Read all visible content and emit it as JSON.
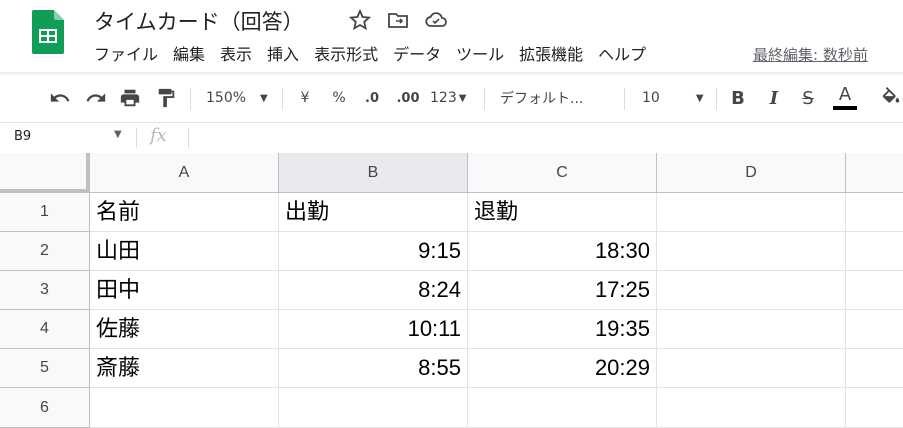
{
  "header": {
    "title": "タイムカード（回答）",
    "menus": [
      "ファイル",
      "編集",
      "表示",
      "挿入",
      "表示形式",
      "データ",
      "ツール",
      "拡張機能",
      "ヘルプ"
    ],
    "last_edit": "最終編集: 数秒前"
  },
  "toolbar": {
    "zoom": "150%",
    "currency": "¥",
    "percent": "%",
    "decrease_decimal": ".0",
    "increase_decimal": ".00",
    "number_format": "123",
    "font": "デフォルト...",
    "font_size": "10",
    "bold": "B",
    "italic": "I",
    "strike": "S",
    "text_color": "A"
  },
  "formula_bar": {
    "name_box": "B9",
    "fx": "fx",
    "value": ""
  },
  "grid": {
    "columns": [
      "A",
      "B",
      "C",
      "D"
    ],
    "rows": [
      "1",
      "2",
      "3",
      "4",
      "5",
      "6"
    ],
    "cells": [
      [
        "名前",
        "出勤",
        "退勤",
        ""
      ],
      [
        "山田",
        "9:15",
        "18:30",
        ""
      ],
      [
        "田中",
        "8:24",
        "17:25",
        ""
      ],
      [
        "佐藤",
        "10:11",
        "19:35",
        ""
      ],
      [
        "斎藤",
        "8:55",
        "20:29",
        ""
      ],
      [
        "",
        "",
        "",
        ""
      ]
    ]
  },
  "colors": {
    "sheets_green": "#0F9D58",
    "header_bg": "#f8f9fa",
    "selected_header_bg": "#e8eaed",
    "grid_line": "#e2e3e3"
  }
}
